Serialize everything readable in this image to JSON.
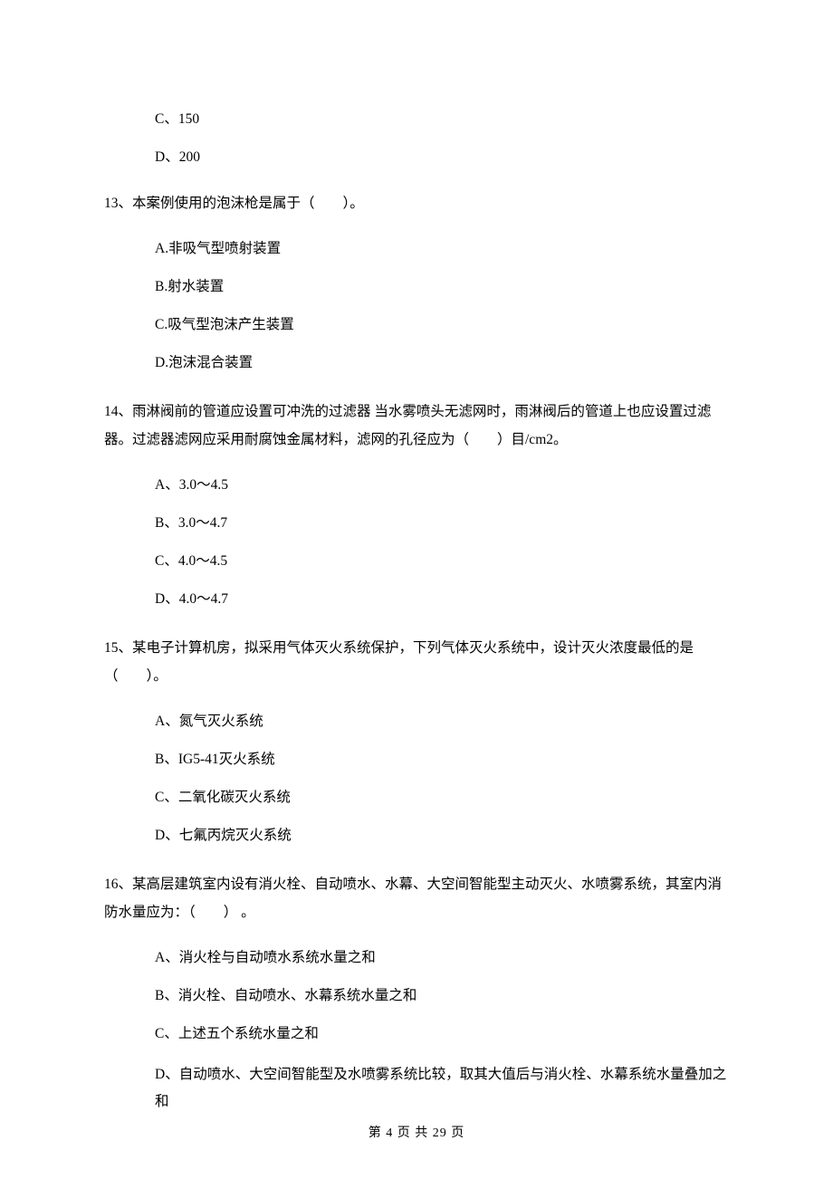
{
  "q12": {
    "optC": "C、150",
    "optD": "D、200"
  },
  "q13": {
    "stem": "13、本案例使用的泡沫枪是属于（　　）。",
    "optA": "A.非吸气型喷射装置",
    "optB": "B.射水装置",
    "optC": "C.吸气型泡沫产生装置",
    "optD": "D.泡沫混合装置"
  },
  "q14": {
    "stem": "14、雨淋阀前的管道应设置可冲洗的过滤器 当水雾喷头无滤网时，雨淋阀后的管道上也应设置过滤器。过滤器滤网应采用耐腐蚀金属材料，滤网的孔径应为（　　）目/cm2。",
    "optA": "A、3.0～4.5",
    "optB": "B、3.0～4.7",
    "optC": "C、4.0～4.5",
    "optD": "D、4.0～4.7"
  },
  "q15": {
    "stem": "15、某电子计算机房，拟采用气体灭火系统保护，下列气体灭火系统中，设计灭火浓度最低的是（　　）。",
    "optA": "A、氮气灭火系统",
    "optB": "B、IG5-41灭火系统",
    "optC": "C、二氧化碳灭火系统",
    "optD": "D、七氟丙烷灭火系统"
  },
  "q16": {
    "stem": "16、某高层建筑室内设有消火栓、自动喷水、水幕、大空间智能型主动灭火、水喷雾系统，其室内消防水量应为：（　　） 。",
    "optA": "A、消火栓与自动喷水系统水量之和",
    "optB": "B、消火栓、自动喷水、水幕系统水量之和",
    "optC": "C、上述五个系统水量之和",
    "optD": "D、自动喷水、大空间智能型及水喷雾系统比较，取其大值后与消火栓、水幕系统水量叠加之和"
  },
  "footer": {
    "text": "第 4 页 共 29 页"
  }
}
